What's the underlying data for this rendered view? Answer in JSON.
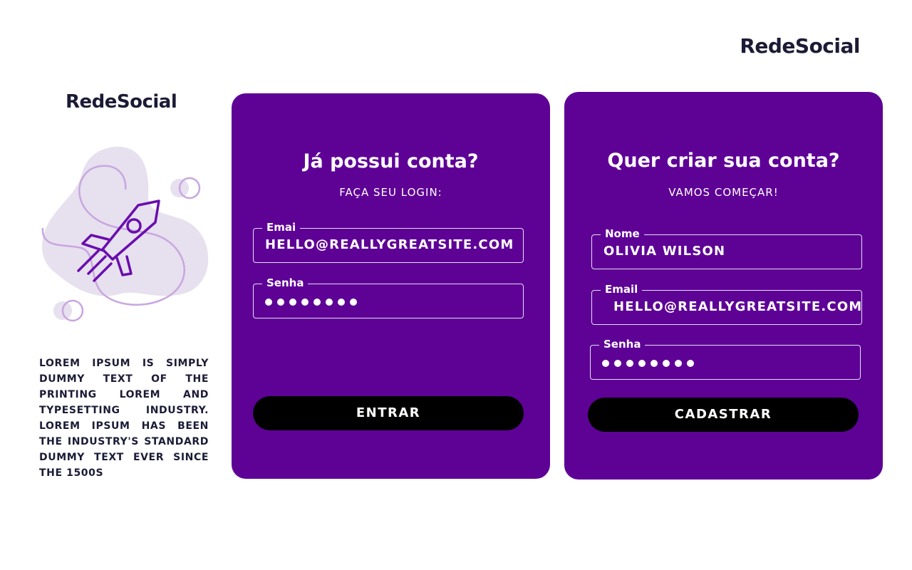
{
  "brand": {
    "top": "RedeSocial",
    "left": "RedeSocial"
  },
  "blurb": "LOREM IPSUM IS SIMPLY DUMMY TEXT OF THE PRINTING LOREM AND TYPESETTING INDUSTRY. LOREM IPSUM HAS BEEN THE INDUSTRY'S STANDARD DUMMY TEXT EVER SINCE THE 1500S",
  "login": {
    "title": "Já possui conta?",
    "subtitle": "FAÇA SEU LOGIN:",
    "email_label": "Emai",
    "email_value": "HELLO@REALLYGREATSITE.COM",
    "password_label": "Senha",
    "password_length": 8,
    "button": "ENTRAR"
  },
  "signup": {
    "title": "Quer criar sua conta?",
    "subtitle": "VAMOS COMEÇAR!",
    "name_label": "Nome",
    "name_value": "OLIVIA WILSON",
    "email_label": "Email",
    "email_value": "HELLO@REALLYGREATSITE.COM",
    "password_label": "Senha",
    "password_length": 8,
    "button": "CADASTRAR"
  },
  "colors": {
    "card": "#5e0296",
    "text_dark": "#1c1b36",
    "button": "#000000",
    "illustration_light": "#e6e0ef",
    "illustration_line": "#c9a6df",
    "rocket": "#6a0dad"
  },
  "icons": {
    "illustration": "rocket-icon"
  }
}
